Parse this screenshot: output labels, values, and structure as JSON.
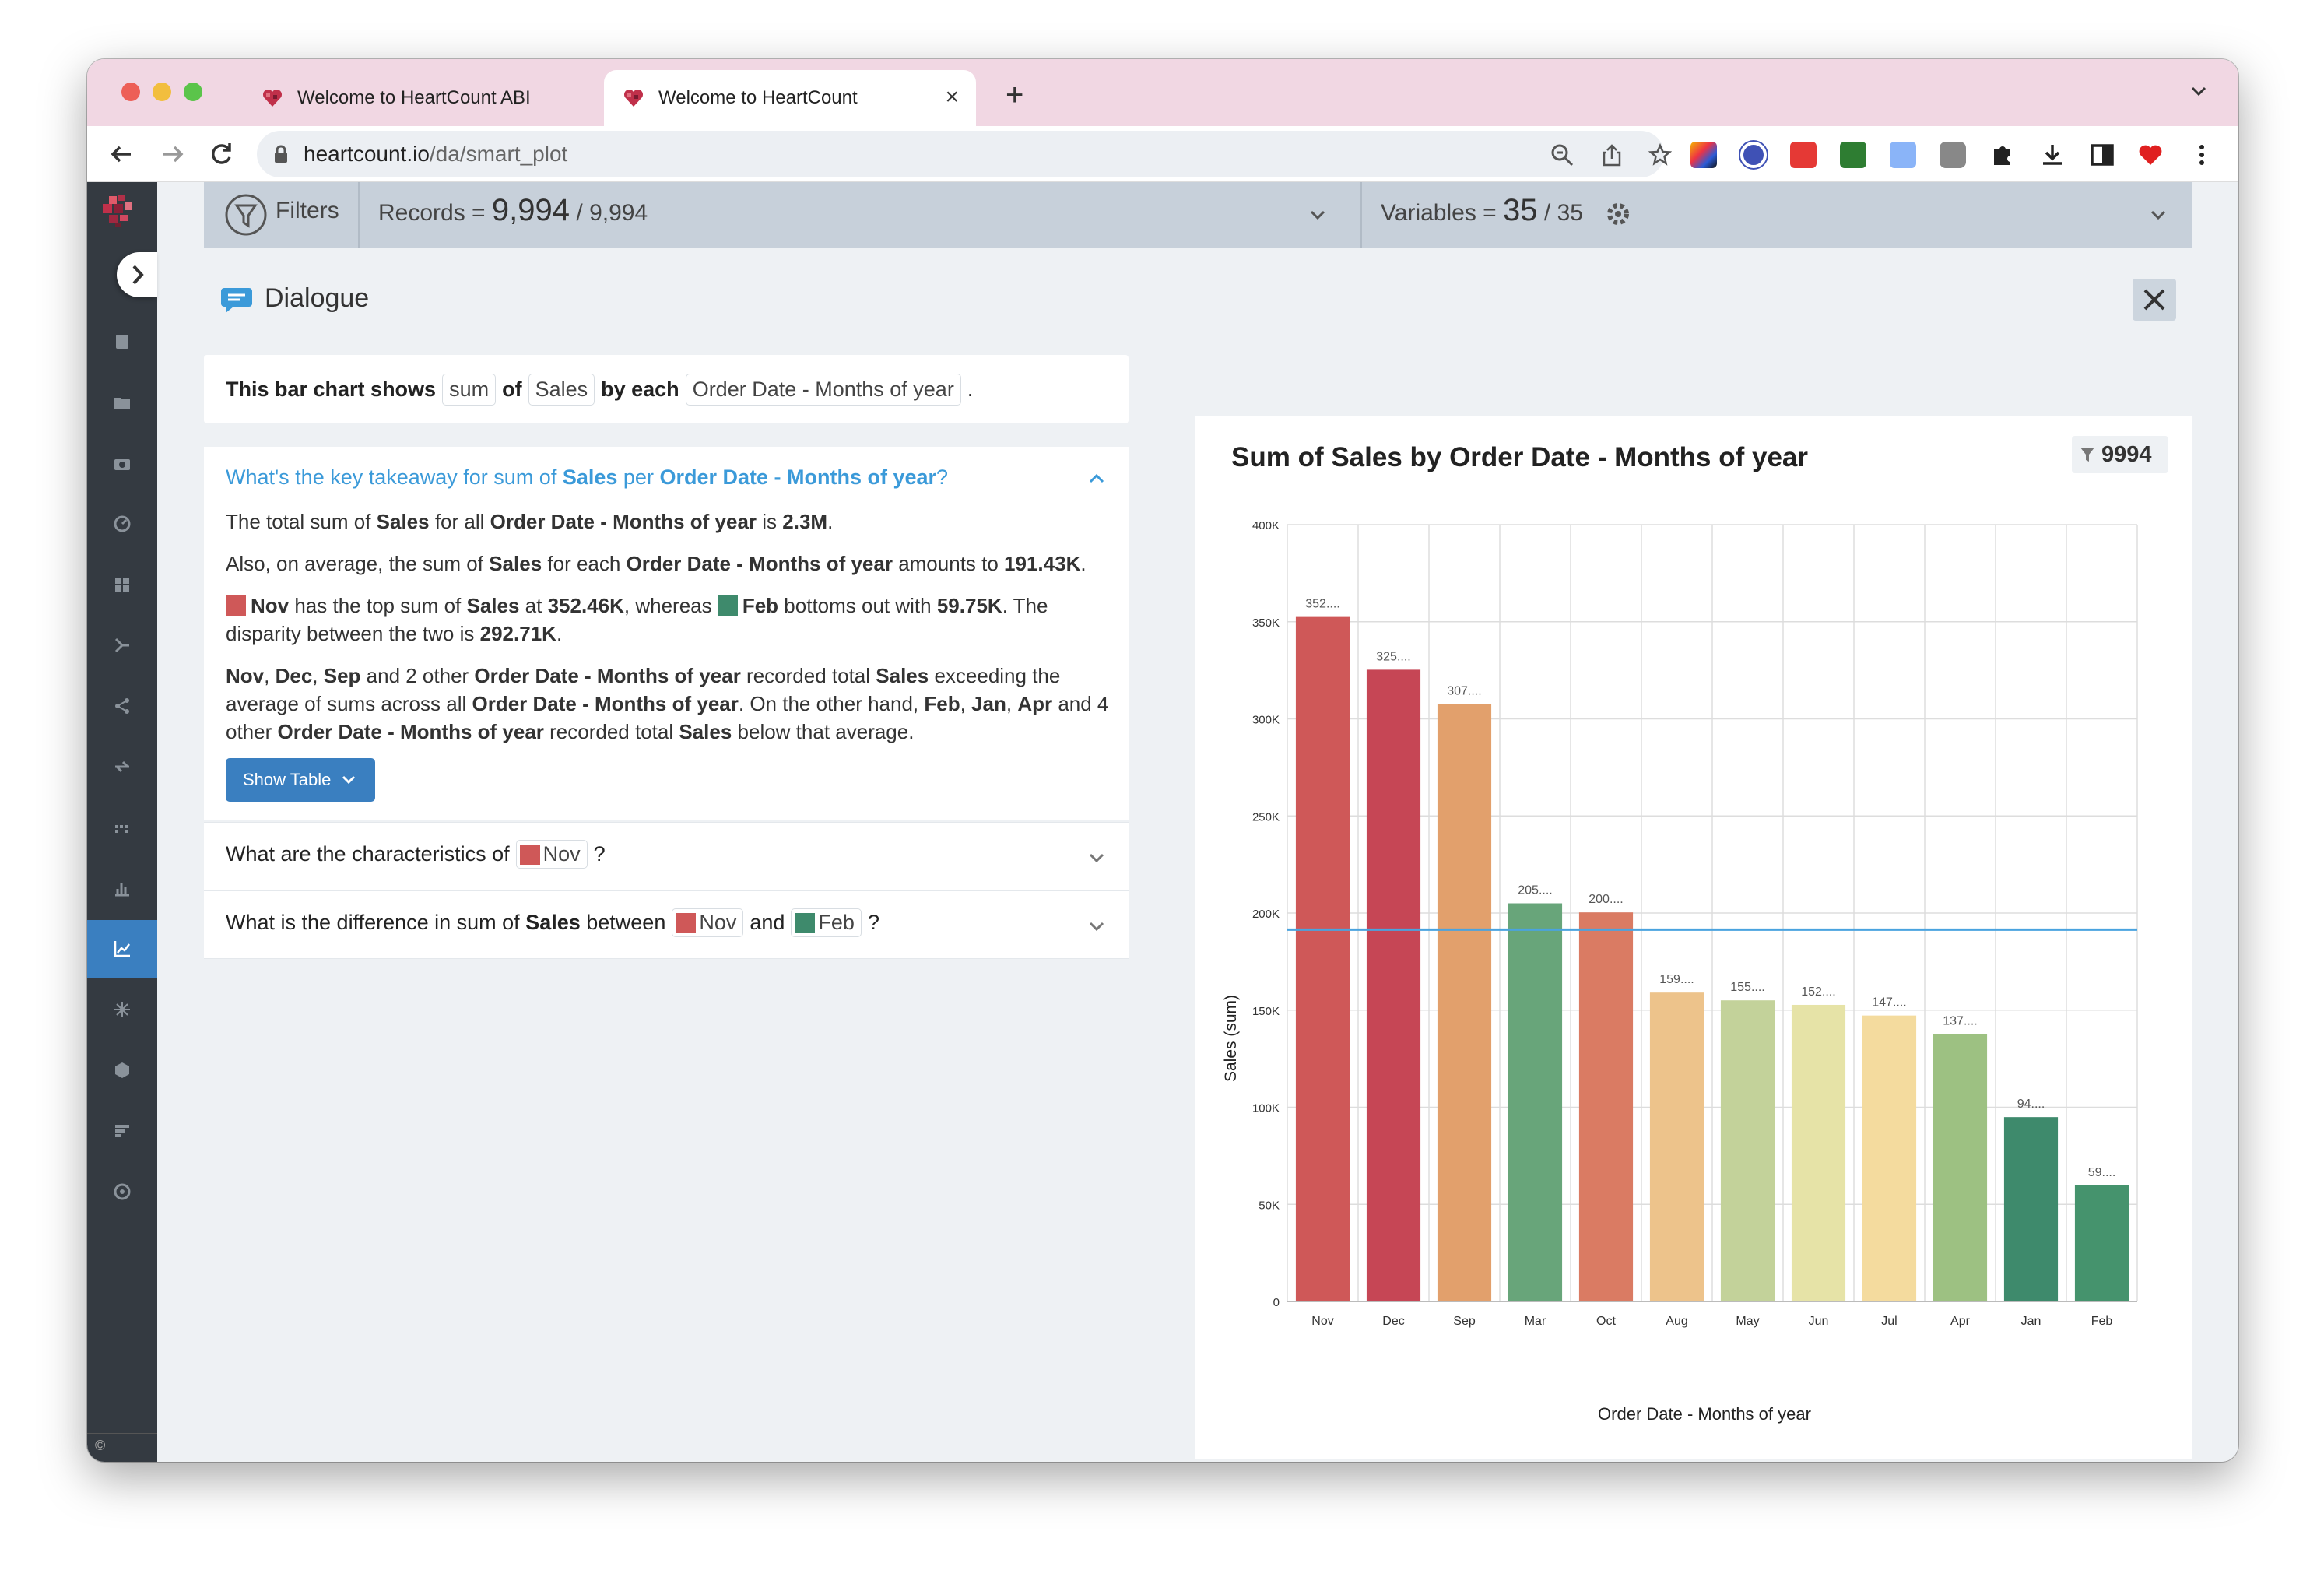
{
  "browser": {
    "tabs": [
      {
        "title": "Welcome to HeartCount ABI",
        "active": false
      },
      {
        "title": "Welcome to HeartCount",
        "active": true
      }
    ],
    "url_host": "heartcount.io",
    "url_path": "/da/smart_plot"
  },
  "filterbar": {
    "filters_label": "Filters",
    "records_label": "Records =",
    "records_value": "9,994",
    "records_sep": "/",
    "records_total": "9,994",
    "variables_label": "Variables =",
    "variables_value": "35",
    "variables_sep": "/",
    "variables_total": "35"
  },
  "dialogue": {
    "title": "Dialogue",
    "summary": {
      "prefix": "This bar chart shows",
      "agg": "sum",
      "of": "of",
      "measure": "Sales",
      "by": "by each",
      "dimension": "Order Date - Months of year",
      "end": "."
    },
    "q1": {
      "t1": "What's the key takeaway for sum of ",
      "t2": "Sales",
      "t3": " per ",
      "t4": "Order Date - Months of year",
      "t5": "?",
      "p1": [
        "The total sum of ",
        "Sales",
        " for all ",
        "Order Date - Months of year",
        " is ",
        "2.3M",
        "."
      ],
      "p2": [
        "Also, on average, the sum of ",
        "Sales",
        " for each ",
        "Order Date - Months of year",
        " amounts to ",
        "191.43K",
        "."
      ],
      "p3": [
        "Nov",
        " has the top sum of ",
        "Sales",
        " at ",
        "352.46K",
        ", whereas ",
        "Feb",
        " bottoms out with ",
        "59.75K",
        ". The disparity between the two is ",
        "292.71K",
        "."
      ],
      "p4": [
        "Nov",
        ", ",
        "Dec",
        ", ",
        "Sep",
        " and 2 other ",
        "Order Date - Months of year",
        " recorded total ",
        "Sales",
        " exceeding the average of sums across all ",
        "Order Date - Months of year",
        ". On the other hand, ",
        "Feb",
        ", ",
        "Jan",
        ", ",
        "Apr",
        " and 4 other ",
        "Order Date - Months of year",
        " recorded total ",
        "Sales",
        " below that average."
      ],
      "show_table": "Show Table"
    },
    "q2": {
      "t1": "What are the characteristics of",
      "chip": "Nov",
      "t2": "?"
    },
    "q3": {
      "t1": "What is the difference in sum of ",
      "t2": "Sales",
      "t3": " between",
      "chip1": "Nov",
      "and": "and",
      "chip2": "Feb",
      "t4": "?"
    }
  },
  "chart_title": "Sum of Sales by Order Date - Months of year",
  "chart_count": "9994",
  "colors": {
    "accent": "#3a7fc0",
    "link": "#3b9ad9",
    "nov": "#cf5858",
    "feb": "#3e8a6c"
  },
  "chart_data": {
    "type": "bar",
    "title": "Sum of Sales by Order Date - Months of year",
    "xlabel": "Order Date - Months of year",
    "ylabel": "Sales (sum)",
    "ylim": [
      0,
      400000
    ],
    "yticks": [
      0,
      50000,
      100000,
      150000,
      200000,
      250000,
      300000,
      350000,
      400000
    ],
    "ytick_labels": [
      "0",
      "50K",
      "100K",
      "150K",
      "200K",
      "250K",
      "300K",
      "350K",
      "400K"
    ],
    "categories": [
      "Nov",
      "Dec",
      "Sep",
      "Mar",
      "Oct",
      "Aug",
      "May",
      "Jun",
      "Jul",
      "Apr",
      "Jan",
      "Feb"
    ],
    "values": [
      352461,
      325294,
      307650,
      205005,
      200323,
      159044,
      155028,
      152719,
      147238,
      137762,
      94925,
      59751
    ],
    "data_labels": [
      "352....",
      "325....",
      "307....",
      "205....",
      "200....",
      "159....",
      "155....",
      "152....",
      "147....",
      "137....",
      "94....",
      "59...."
    ],
    "bar_colors": [
      "#cf5858",
      "#c64655",
      "#e2a06c",
      "#68a57a",
      "#da7b63",
      "#edc38b",
      "#c3d29a",
      "#e6e3a7",
      "#f4db9e",
      "#9dc182",
      "#3e8a6c",
      "#45936d"
    ],
    "average": 191430,
    "grid": true
  }
}
